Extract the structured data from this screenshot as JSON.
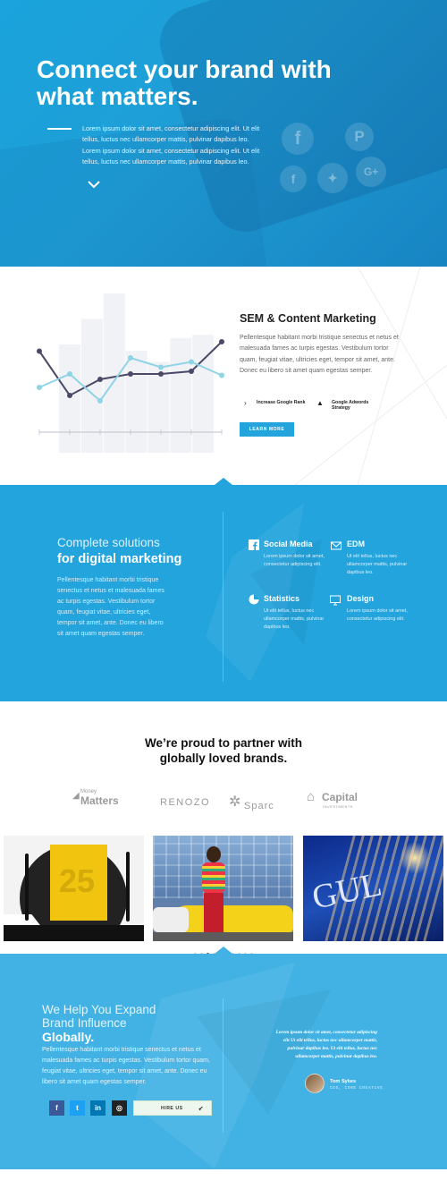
{
  "hero": {
    "title": "Connect your brand with what matters.",
    "text": "Lorem ipsum dolor sit amet, consectetur adipiscing elit. Ut elit tellus, luctus nec ullamcorper mattis, pulvinar dapibus leo. Lorem ipsum dolor sit amet, consectetur adipiscing elit. Ut elit tellus, luctus nec ullamcorper mattis, pulvinar dapibus leo.",
    "social_glyphs": [
      "f",
      "P",
      "G+"
    ]
  },
  "sem": {
    "title": "SEM & Content Marketing",
    "text": "Pellentesque habitant morbi tristique senectus et netus et malesuada fames ac turpis egestas. Vestibulum tortor quam, feugiat vitae, ultricies eget, tempor sit amet, ante. Donec eu libero sit amet quam egestas semper.",
    "features": [
      {
        "label": "Increase Google Rank",
        "icon": "chevron-right-icon"
      },
      {
        "label": "Google Adwords Strategy",
        "icon": "adwords-icon"
      }
    ],
    "button": "LEARN MORE",
    "chart_data": {
      "type": "line",
      "categories": [
        "1",
        "2",
        "3",
        "4",
        "5",
        "6",
        "7"
      ],
      "bars": [
        68,
        84,
        100,
        64,
        57,
        72,
        74
      ],
      "series": [
        {
          "values": [
            57,
            24,
            36,
            40,
            40,
            42,
            64
          ],
          "color": "#4a4a68"
        },
        {
          "values": [
            30,
            40,
            20,
            52,
            45,
            49,
            39
          ],
          "color": "#8fd3e6"
        }
      ],
      "ylim": [
        0,
        100
      ]
    }
  },
  "complete": {
    "title_light": "Complete solutions",
    "title_bold": "for digital marketing",
    "text": "Pellentesque habitant morbi tristique senectus et netus et malesuada fames ac turpis egestas. Vestibulum tortor quam, feugiat vitae, ultricies eget, tempor sit amet, ante. Donec eu libero sit amet quam egestas semper.",
    "services": [
      {
        "title": "Social Media",
        "text": "Lorem ipsum dolor sit amet, consectetur adipiscing elit.",
        "icon": "facebook-icon"
      },
      {
        "title": "EDM",
        "text": "Ut elit tellus, luctus nec ullamcorper mattis, pulvinar dapibus leo.",
        "icon": "mail-icon"
      },
      {
        "title": "Statistics",
        "text": "Ut elit tellus, luctus nec ullamcorper mattis, pulvinar dapibus leo.",
        "icon": "pie-chart-icon"
      },
      {
        "title": "Design",
        "text": "Lorem ipsum dolor sit amet, consectetur adipiscing elit.",
        "icon": "monitor-icon"
      }
    ]
  },
  "partners": {
    "title_line1": "We’re proud to partner with",
    "title_line2": "globally loved brands.",
    "logos": [
      {
        "small": "Money",
        "big": "Matters"
      },
      {
        "big": "RENOZO"
      },
      {
        "big": "Sparc"
      },
      {
        "big": "Capital",
        "small": "INVESTMENTS"
      }
    ],
    "photos": [
      "book-photo",
      "woman-photo",
      "building-photo"
    ],
    "slider_dots": 10,
    "active_dot": 2
  },
  "expand": {
    "title_line1": "We Help You Expand",
    "title_line2": "Brand Influence",
    "title_bold": "Globally.",
    "text": "Pellentesque habitant morbi tristique senectus et netus et malesuada fames ac turpis egestas. Vestibulum tortor quam, feugiat vitae, ultricies eget, tempor sit amet, ante. Donec eu libero sit amet quam egestas semper.",
    "social": [
      {
        "glyph": "f",
        "color": "#3b5998",
        "name": "facebook"
      },
      {
        "glyph": "t",
        "color": "#1da1f2",
        "name": "twitter"
      },
      {
        "glyph": "in",
        "color": "#0077b5",
        "name": "linkedin"
      },
      {
        "glyph": "◎",
        "color": "#222222",
        "name": "instagram"
      }
    ],
    "hire_label": "HIRE US",
    "quote": "Lorem ipsum dolor sit amet, consectetur adipiscing elit Ut elit tellus, luctus nec ullamcorper mattis, pulvinar dapibus leo. Ut elit tellus, luctus nec ullamcorper mattis, pulvinar dapibus leo.",
    "person": "Tom Sykes",
    "role": "CEO, CORE CREATIVE"
  }
}
